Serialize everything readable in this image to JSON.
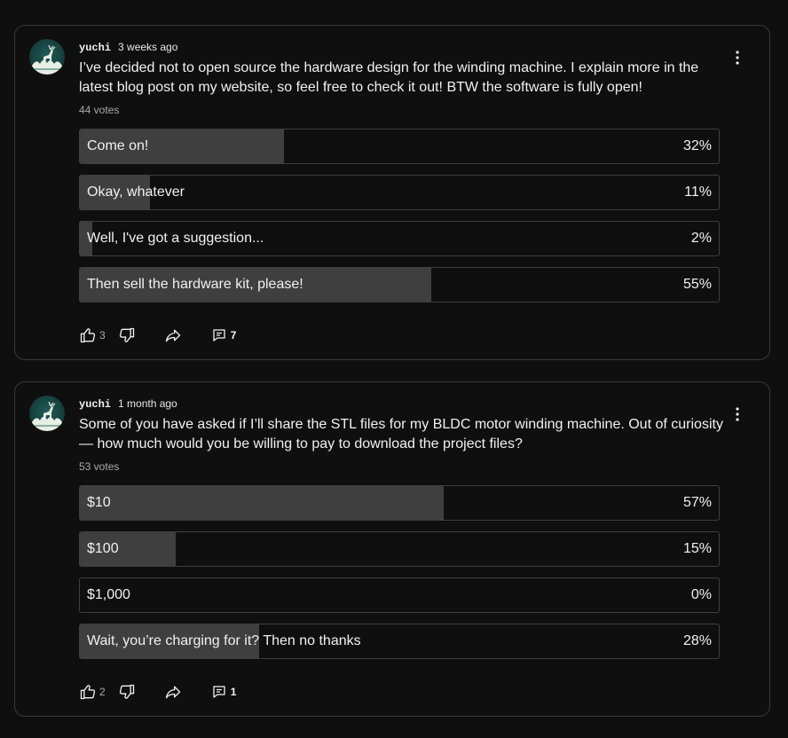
{
  "posts": [
    {
      "author": "yuchi",
      "time": "3 weeks ago",
      "text": "I’ve decided not to open source the hardware design for the winding machine. I explain more in the latest blog post on my website, so feel free to check it out! BTW the software is fully open!",
      "votes": "44 votes",
      "options": [
        {
          "label": "Come on!",
          "percent": "32%",
          "fill": 0.32
        },
        {
          "label": "Okay, whatever",
          "percent": "11%",
          "fill": 0.11
        },
        {
          "label": "Well, I've got a suggestion...",
          "percent": "2%",
          "fill": 0.02
        },
        {
          "label": "Then sell the hardware kit, please!",
          "percent": "55%",
          "fill": 0.55
        }
      ],
      "likes": "3",
      "comments": "7"
    },
    {
      "author": "yuchi",
      "time": "1 month ago",
      "text": "Some of you have asked if I’ll share the STL files for my BLDC motor winding machine. Out of curiosity — how much would you be willing to pay to download the project files?",
      "votes": "53 votes",
      "options": [
        {
          "label": "$10",
          "percent": "57%",
          "fill": 0.57
        },
        {
          "label": "$100",
          "percent": "15%",
          "fill": 0.15
        },
        {
          "label": "$1,000",
          "percent": "0%",
          "fill": 0
        },
        {
          "label": "Wait, you’re charging for it? Then no thanks",
          "percent": "28%",
          "fill": 0.28
        }
      ],
      "likes": "2",
      "comments": "1"
    }
  ],
  "icons": {
    "avatar": "deer-avatar-icon",
    "menu": "more-vertical-icon",
    "like": "thumbs-up-icon",
    "dislike": "thumbs-down-icon",
    "share": "share-icon",
    "comments": "comment-icon"
  },
  "colors": {
    "background": "#0f0f0f",
    "border": "#3a3a3a",
    "fill": "#3f3f3f",
    "text": "#f1f1f1",
    "muted": "#aaaaaa",
    "avatar": "#1f5b57"
  }
}
